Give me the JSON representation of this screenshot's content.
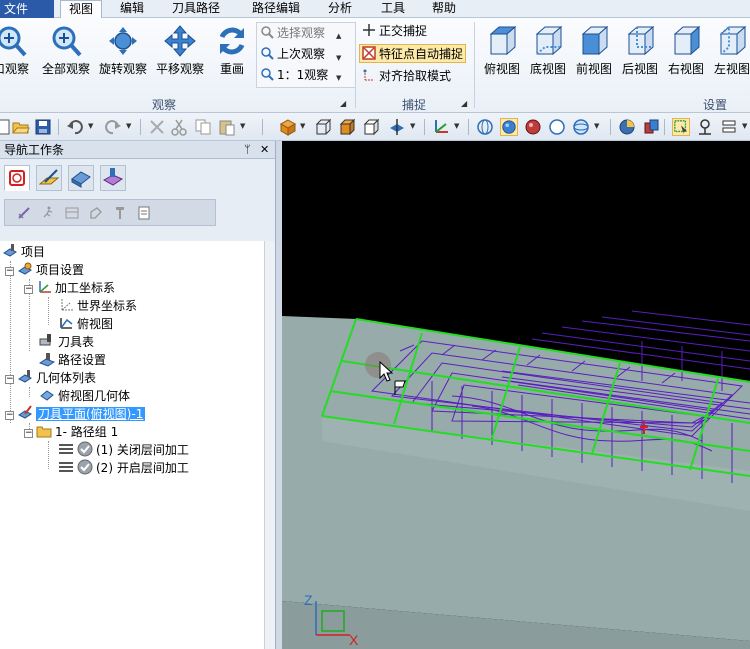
{
  "menubar": {
    "file": "文件",
    "items": [
      "视图",
      "编辑",
      "刀具路径",
      "路径编辑",
      "分析",
      "工具",
      "帮助"
    ],
    "active": "视图"
  },
  "ribbon": {
    "view_group": {
      "label": "观察",
      "buttons": [
        "口观察",
        "全部观察",
        "旋转观察",
        "平移观察",
        "重画"
      ],
      "small": [
        "选择观察",
        "上次观察",
        "1：1观察"
      ]
    },
    "snap_group": {
      "label": "捕捉",
      "items": [
        "正交捕捉",
        "特征点自动捕捉",
        "对齐拾取模式"
      ]
    },
    "settings_group": {
      "label": "设置",
      "views": [
        "俯视图",
        "底视图",
        "前视图",
        "后视图",
        "右视图",
        "左视图"
      ]
    }
  },
  "nav": {
    "title": "导航工作条",
    "pin": "ᛘ",
    "close": "✕",
    "tree": {
      "root": "项目",
      "project_settings": "项目设置",
      "coord_system": "加工坐标系",
      "world_coord": "世界坐标系",
      "top_view": "俯视图",
      "tool_table": "刀具表",
      "path_settings": "路径设置",
      "geometry_list": "几何体列表",
      "top_view_geometry": "俯视图几何体",
      "tool_plane": "刀具平面(俯视图)-1",
      "path_group": "1- 路径组 1",
      "op1": "(1) 关闭层间加工",
      "op2": "(2) 开启层间加工"
    }
  },
  "viewport": {
    "axis_labels": {
      "z": "Z",
      "x": "X"
    },
    "colors": {
      "bg": "#000000",
      "part": "#98abab",
      "wire": "#22dd22",
      "toolpath": "#5a1ebe"
    }
  }
}
